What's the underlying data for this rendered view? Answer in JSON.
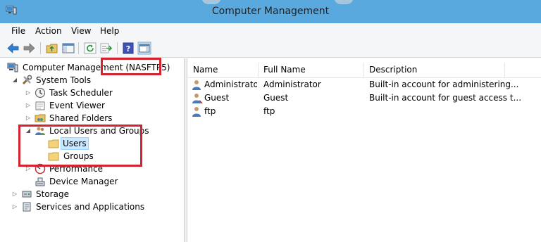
{
  "window": {
    "title": "Computer Management",
    "app_icon": "computer-management-icon"
  },
  "menu": [
    "File",
    "Action",
    "View",
    "Help"
  ],
  "toolbar": {
    "buttons": [
      "back-icon",
      "forward-icon",
      "up-folder-icon",
      "show-hide-tree-icon",
      "refresh-icon",
      "export-list-icon",
      "help-icon",
      "show-hide-action-pane-icon"
    ]
  },
  "tree": {
    "root": "Computer Management (NASFTP5)",
    "system_tools": "System Tools",
    "task_scheduler": "Task Scheduler",
    "event_viewer": "Event Viewer",
    "shared_folders": "Shared Folders",
    "local_users_groups": "Local Users and Groups",
    "users": "Users",
    "groups": "Groups",
    "performance": "Performance",
    "device_manager": "Device Manager",
    "storage": "Storage",
    "services_apps": "Services and Applications"
  },
  "list": {
    "columns": [
      "Name",
      "Full Name",
      "Description"
    ],
    "rows": [
      {
        "name": "Administrator",
        "full_name": "Administrator",
        "description": "Built-in account for administering..."
      },
      {
        "name": "Guest",
        "full_name": "Guest",
        "description": "Built-in account for guest access t..."
      },
      {
        "name": "ftp",
        "full_name": "ftp",
        "description": ""
      }
    ]
  },
  "colors": {
    "titlebar": "#5aa9de",
    "selection": "#cce8ff",
    "highlight_box": "#d42330"
  }
}
